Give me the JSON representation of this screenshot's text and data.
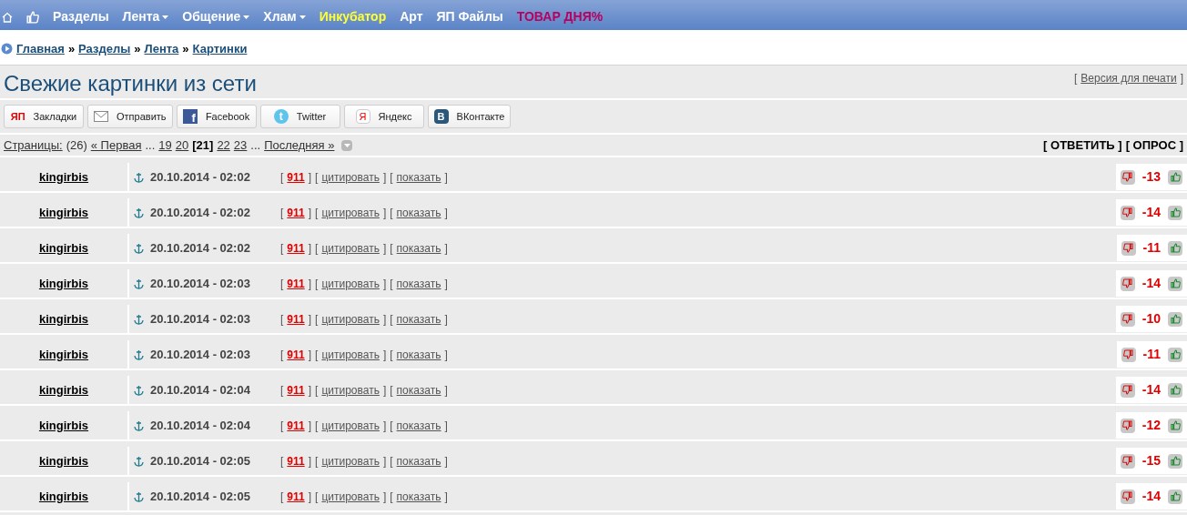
{
  "nav": {
    "items": [
      {
        "label": "Разделы",
        "has_menu": false,
        "color": "#ffffff"
      },
      {
        "label": "Лента",
        "has_menu": true,
        "color": "#ffffff"
      },
      {
        "label": "Общение",
        "has_menu": true,
        "color": "#ffffff"
      },
      {
        "label": "Хлам",
        "has_menu": true,
        "color": "#ffffff"
      },
      {
        "label": "Инкубатор",
        "has_menu": false,
        "color": "#ffff33"
      },
      {
        "label": "Арт",
        "has_menu": false,
        "color": "#ffffff"
      },
      {
        "label": "ЯП Файлы",
        "has_menu": false,
        "color": "#ffffff"
      },
      {
        "label": "ТОВАР ДНЯ%",
        "has_menu": false,
        "color": "#b8005f"
      }
    ]
  },
  "bracket_open": "[",
  "bracket_close": "]",
  "breadcrumb": [
    "Главная",
    "Разделы",
    "Лента",
    "Картинки"
  ],
  "breadcrumb_separator": "»",
  "title": "Свежие картинки из сети",
  "print_link": "Версия для печати",
  "share_buttons": [
    {
      "kind": "yap",
      "label": "Закладки",
      "icon_text": "ЯП"
    },
    {
      "kind": "mail",
      "label": "Отправить"
    },
    {
      "kind": "facebook",
      "label": "Facebook",
      "icon_text": "f"
    },
    {
      "kind": "twitter",
      "label": "Twitter",
      "icon_text": "t"
    },
    {
      "kind": "yandex",
      "label": "Яндекс",
      "icon_text": "Я"
    },
    {
      "kind": "vk",
      "label": "ВКонтакте",
      "icon_text": "B"
    }
  ],
  "pagination": {
    "label": "Страницы:",
    "count": "(26)",
    "first": "« Первая",
    "ellipsis": "...",
    "pages": [
      {
        "label": "19",
        "selected": false
      },
      {
        "label": "20",
        "selected": false
      },
      {
        "label": "[21]",
        "selected": true
      },
      {
        "label": "22",
        "selected": false
      },
      {
        "label": "23",
        "selected": false
      }
    ],
    "last": "Последняя »"
  },
  "actions": [
    "[ ОТВЕТИТЬ ]",
    "[ ОПРОС ]"
  ],
  "posts": [
    {
      "author": "kingirbis",
      "date": "20.10.2014 - 02:02",
      "number": "911",
      "quote": "цитировать",
      "show": "показать",
      "rating": "-13"
    },
    {
      "author": "kingirbis",
      "date": "20.10.2014 - 02:02",
      "number": "911",
      "quote": "цитировать",
      "show": "показать",
      "rating": "-14"
    },
    {
      "author": "kingirbis",
      "date": "20.10.2014 - 02:02",
      "number": "911",
      "quote": "цитировать",
      "show": "показать",
      "rating": "-11"
    },
    {
      "author": "kingirbis",
      "date": "20.10.2014 - 02:03",
      "number": "911",
      "quote": "цитировать",
      "show": "показать",
      "rating": "-14"
    },
    {
      "author": "kingirbis",
      "date": "20.10.2014 - 02:03",
      "number": "911",
      "quote": "цитировать",
      "show": "показать",
      "rating": "-10"
    },
    {
      "author": "kingirbis",
      "date": "20.10.2014 - 02:03",
      "number": "911",
      "quote": "цитировать",
      "show": "показать",
      "rating": "-11"
    },
    {
      "author": "kingirbis",
      "date": "20.10.2014 - 02:04",
      "number": "911",
      "quote": "цитировать",
      "show": "показать",
      "rating": "-14"
    },
    {
      "author": "kingirbis",
      "date": "20.10.2014 - 02:04",
      "number": "911",
      "quote": "цитировать",
      "show": "показать",
      "rating": "-12"
    },
    {
      "author": "kingirbis",
      "date": "20.10.2014 - 02:05",
      "number": "911",
      "quote": "цитировать",
      "show": "показать",
      "rating": "-15"
    },
    {
      "author": "kingirbis",
      "date": "20.10.2014 - 02:05",
      "number": "911",
      "quote": "цитировать",
      "show": "показать",
      "rating": "-14"
    }
  ]
}
